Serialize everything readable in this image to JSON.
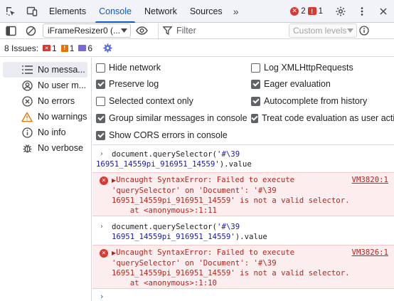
{
  "tabs": {
    "items": [
      "Elements",
      "Console",
      "Network",
      "Sources"
    ],
    "active": "Console",
    "more_label": "»",
    "error_count": "2",
    "warning_count": "1"
  },
  "toolbar": {
    "context": "iFrameResizer0 (...",
    "filter_placeholder": "Filter",
    "levels": "Custom levels"
  },
  "issues": {
    "label": "8 Issues:",
    "errors": "1",
    "warnings": "1",
    "info": "6"
  },
  "sidebar": {
    "items": [
      {
        "label": "No messa...",
        "icon": "list-icon"
      },
      {
        "label": "No user m...",
        "icon": "user-icon"
      },
      {
        "label": "No errors",
        "icon": "error-icon"
      },
      {
        "label": "No warnings",
        "icon": "warning-icon"
      },
      {
        "label": "No info",
        "icon": "info-icon"
      },
      {
        "label": "No verbose",
        "icon": "bug-icon"
      }
    ]
  },
  "settings": {
    "hide_network": {
      "label": "Hide network",
      "checked": false
    },
    "preserve_log": {
      "label": "Preserve log",
      "checked": true
    },
    "selected_context": {
      "label": "Selected context only",
      "checked": false
    },
    "group_similar": {
      "label": "Group similar messages in console",
      "checked": true
    },
    "show_cors": {
      "label": "Show CORS errors in console",
      "checked": true
    },
    "log_xhr": {
      "label": "Log XMLHttpRequests",
      "checked": false
    },
    "eager_eval": {
      "label": "Eager evaluation",
      "checked": true
    },
    "autocomplete": {
      "label": "Autocomplete from history",
      "checked": true
    },
    "treat_code": {
      "label": "Treat code evaluation as user action",
      "checked": true
    }
  },
  "console": {
    "cmd1_line1_pre": "document.querySelector(",
    "cmd1_line1_str": "'#\\39",
    "cmd1_line2_str": "16951_14559pi_916951_14559'",
    "cmd1_line2_post": ").value",
    "err1": {
      "line1": "Uncaught SyntaxError: Failed to execute",
      "line2": "'querySelector' on 'Document': '#\\39",
      "line3": "16951_14559pi_916951_14559' is not a valid selector.",
      "line4": "    at <anonymous>:1:11",
      "source": "VM3820:1"
    },
    "cmd2_line1_pre": "document.querySelector(",
    "cmd2_line1_str": "'#\\39",
    "cmd2_line2_str": "16951_14559pi_916951_14559'",
    "cmd2_line2_post": ").value",
    "err2": {
      "line1": "Uncaught SyntaxError: Failed to execute",
      "line2": "'querySelector' on 'Document': '#\\39",
      "line3": "16951_14559pi_916951_14559' is not a valid selector.",
      "line4": "    at <anonymous>:1:10",
      "source": "VM3826:1"
    }
  },
  "colors": {
    "accent": "#0b57d0",
    "error": "#dc362e",
    "error_bg": "#fceeee"
  }
}
